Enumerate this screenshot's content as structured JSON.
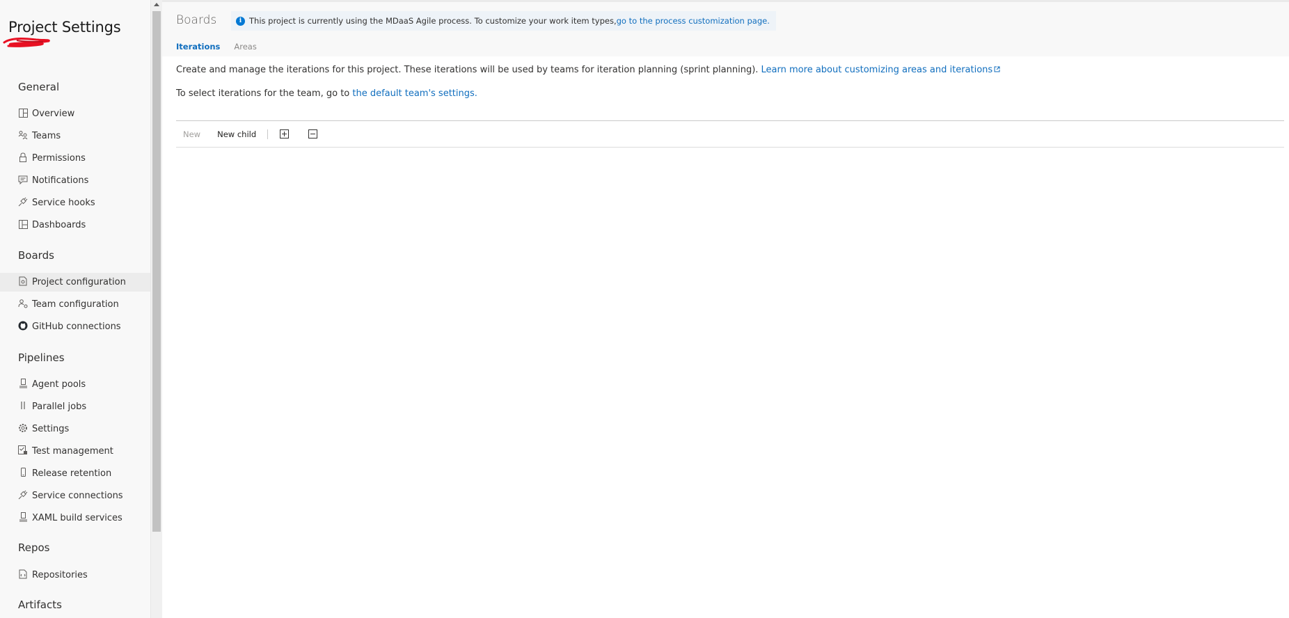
{
  "sidebar": {
    "title": "Project Settings",
    "sections": {
      "general": "General",
      "boards": "Boards",
      "pipelines": "Pipelines",
      "repos": "Repos",
      "artifacts": "Artifacts"
    },
    "general_items": [
      {
        "label": "Overview",
        "icon": "overview-icon"
      },
      {
        "label": "Teams",
        "icon": "teams-icon"
      },
      {
        "label": "Permissions",
        "icon": "lock-icon"
      },
      {
        "label": "Notifications",
        "icon": "chat-bubble-icon"
      },
      {
        "label": "Service hooks",
        "icon": "plug-icon"
      },
      {
        "label": "Dashboards",
        "icon": "dashboard-icon"
      }
    ],
    "boards_items": [
      {
        "label": "Project configuration",
        "icon": "document-settings-icon",
        "active": true
      },
      {
        "label": "Team configuration",
        "icon": "team-settings-icon"
      },
      {
        "label": "GitHub connections",
        "icon": "github-icon"
      }
    ],
    "pipelines_items": [
      {
        "label": "Agent pools",
        "icon": "agent-pool-icon"
      },
      {
        "label": "Parallel jobs",
        "icon": "parallel-icon"
      },
      {
        "label": "Settings",
        "icon": "gear-icon"
      },
      {
        "label": "Test management",
        "icon": "test-management-icon"
      },
      {
        "label": "Release retention",
        "icon": "phone-icon"
      },
      {
        "label": "Service connections",
        "icon": "plug-icon"
      },
      {
        "label": "XAML build services",
        "icon": "build-agent-icon"
      }
    ],
    "repos_items": [
      {
        "label": "Repositories",
        "icon": "repository-icon"
      }
    ]
  },
  "header": {
    "title": "Boards",
    "info_text": "This project is currently using the MDaaS Agile process. To customize your work item types, ",
    "info_link": "go to the process customization page."
  },
  "tabs": {
    "iterations": "Iterations",
    "areas": "Areas"
  },
  "content": {
    "description": "Create and manage the iterations for this project. These iterations will be used by teams for iteration planning (sprint planning). ",
    "learn_more_link": "Learn more about customizing areas and iterations",
    "team_text": "To select iterations for the team, go to ",
    "team_link": "the default team's settings."
  },
  "toolbar": {
    "new_label": "New",
    "new_child_label": "New child",
    "expand_icon": "expand-all-icon",
    "collapse_icon": "collapse-all-icon"
  },
  "colors": {
    "accent": "#106ebe",
    "info_icon": "#0078d4",
    "sidebar_bg": "#f8f8f8",
    "active_item_bg": "#ececec",
    "redaction": "#e81123"
  }
}
